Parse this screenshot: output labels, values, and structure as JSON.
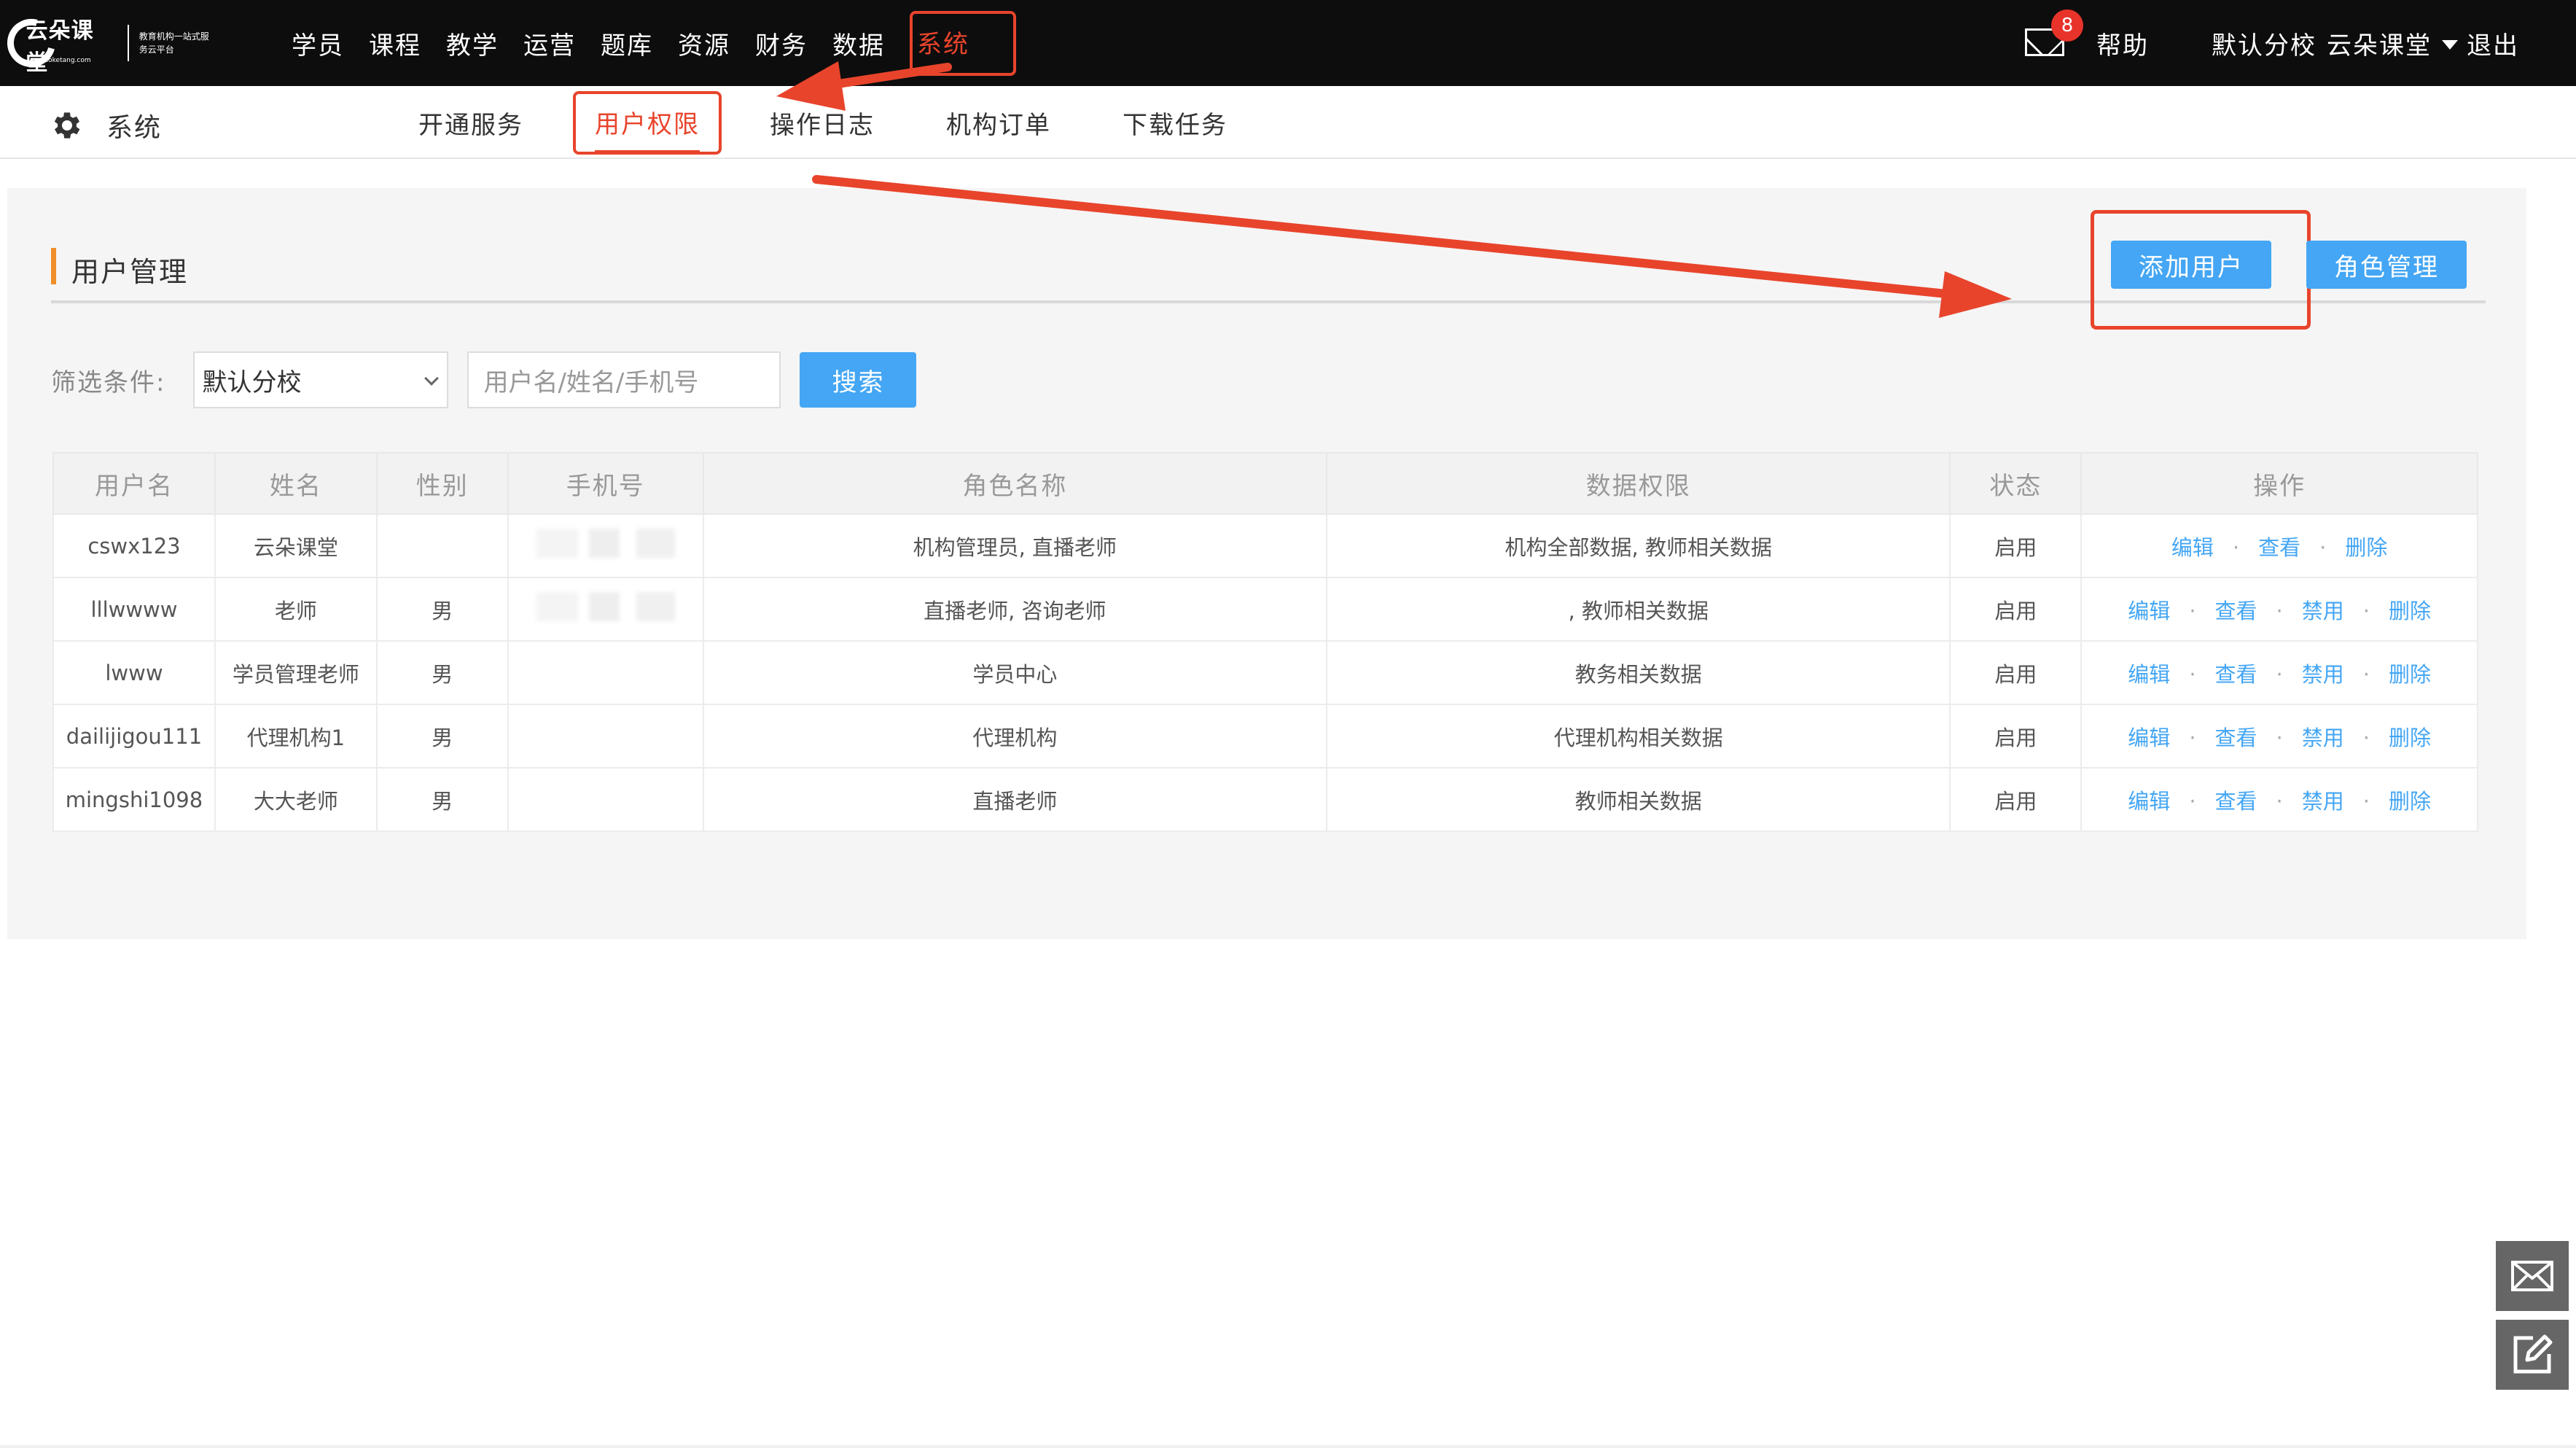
{
  "brand": {
    "name": "云朵课堂",
    "sub": "yunduoketang.com",
    "slogan": "教育机构一站式服务云平台"
  },
  "top_nav": {
    "items": [
      "学员",
      "课程",
      "教学",
      "运营",
      "题库",
      "资源",
      "财务",
      "数据",
      "系统"
    ],
    "active": "系统",
    "mail_count": "8",
    "help": "帮助",
    "branch": "默认分校",
    "org": "云朵课堂",
    "logout": "退出"
  },
  "sub_nav": {
    "section": "系统",
    "items": [
      "开通服务",
      "用户权限",
      "操作日志",
      "机构订单",
      "下载任务"
    ],
    "active": "用户权限"
  },
  "panel": {
    "title": "用户管理",
    "add_user": "添加用户",
    "role_manage": "角色管理"
  },
  "filter": {
    "label": "筛选条件:",
    "branch_selected": "默认分校",
    "search_placeholder": "用户名/姓名/手机号",
    "search_button": "搜索"
  },
  "table": {
    "headers": [
      "用户名",
      "姓名",
      "性别",
      "手机号",
      "角色名称",
      "数据权限",
      "状态",
      "操作"
    ],
    "rows": [
      {
        "username": "cswx123",
        "name": "云朵课堂",
        "gender": "",
        "phone": "",
        "roles": "机构管理员, 直播老师",
        "data_scope": "机构全部数据, 教师相关数据",
        "status": "启用",
        "ops": [
          "编辑",
          "查看",
          "删除"
        ]
      },
      {
        "username": "lllwwww",
        "name": "老师",
        "gender": "男",
        "phone": "",
        "roles": "直播老师, 咨询老师",
        "data_scope": ", 教师相关数据",
        "status": "启用",
        "ops": [
          "编辑",
          "查看",
          "禁用",
          "删除"
        ]
      },
      {
        "username": "lwww",
        "name": "学员管理老师",
        "gender": "男",
        "phone": "",
        "roles": "学员中心",
        "data_scope": "教务相关数据",
        "status": "启用",
        "ops": [
          "编辑",
          "查看",
          "禁用",
          "删除"
        ]
      },
      {
        "username": "dailijigou111",
        "name": "代理机构1",
        "gender": "男",
        "phone": "",
        "roles": "代理机构",
        "data_scope": "代理机构相关数据",
        "status": "启用",
        "ops": [
          "编辑",
          "查看",
          "禁用",
          "删除"
        ]
      },
      {
        "username": "mingshi1098",
        "name": "大大老师",
        "gender": "男",
        "phone": "",
        "roles": "直播老师",
        "data_scope": "教师相关数据",
        "status": "启用",
        "ops": [
          "编辑",
          "查看",
          "禁用",
          "删除"
        ]
      }
    ]
  },
  "colors": {
    "topbar": "#0d0d0d",
    "accent_red": "#e8442c",
    "button_blue": "#44a6f4",
    "title_mark": "#f08f2a"
  },
  "icons": [
    "gear-icon",
    "mail-icon",
    "chevron-down-icon",
    "float-mail-icon",
    "float-edit-icon"
  ]
}
